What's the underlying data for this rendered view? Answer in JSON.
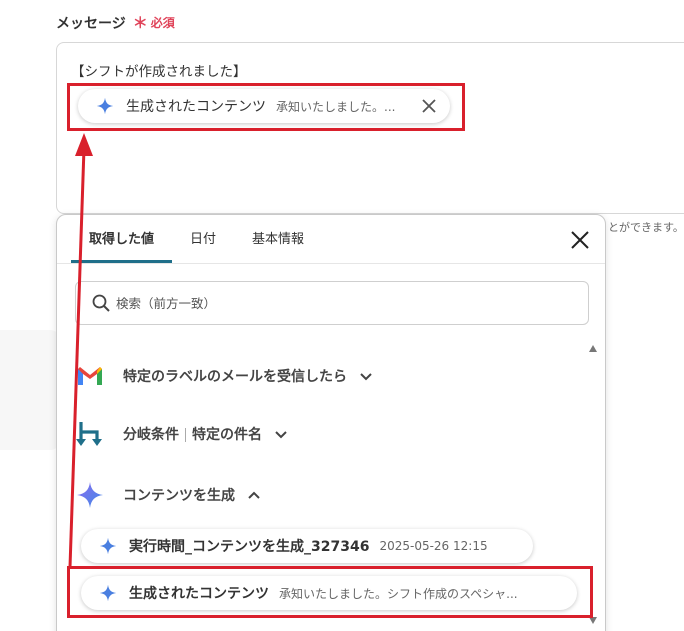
{
  "field": {
    "label": "メッセージ",
    "required_mark": "＊",
    "required_text": "必須",
    "message_text": "【シフトが作成されました】",
    "helper_text": "とができます。"
  },
  "inserted_chip": {
    "name": "生成されたコンテンツ",
    "preview": "承知いたしました。..."
  },
  "panel": {
    "tabs": [
      {
        "label": "取得した値",
        "active": true
      },
      {
        "label": "日付",
        "active": false
      },
      {
        "label": "基本情報",
        "active": false
      }
    ],
    "search_placeholder": "検索（前方一致）",
    "sections": [
      {
        "label": "特定のラベルのメールを受信したら",
        "icon": "gmail-icon",
        "expanded": false
      },
      {
        "label_a": "分岐条件",
        "label_b": "特定の件名",
        "icon": "branch-icon",
        "expanded": false
      },
      {
        "label": "コンテンツを生成",
        "icon": "sparkle-icon",
        "expanded": true
      }
    ],
    "items": [
      {
        "name": "実行時間_コンテンツを生成_327346",
        "preview": "2025-05-26 12:15"
      },
      {
        "name": "生成されたコンテンツ",
        "preview": "承知いたしました。シフト作成のスペシャ..."
      }
    ]
  },
  "colors": {
    "accent_tab": "#1f6f8a",
    "required": "#e0445a",
    "highlight": "#d9202c",
    "sparkle": "#4a7fe0"
  }
}
